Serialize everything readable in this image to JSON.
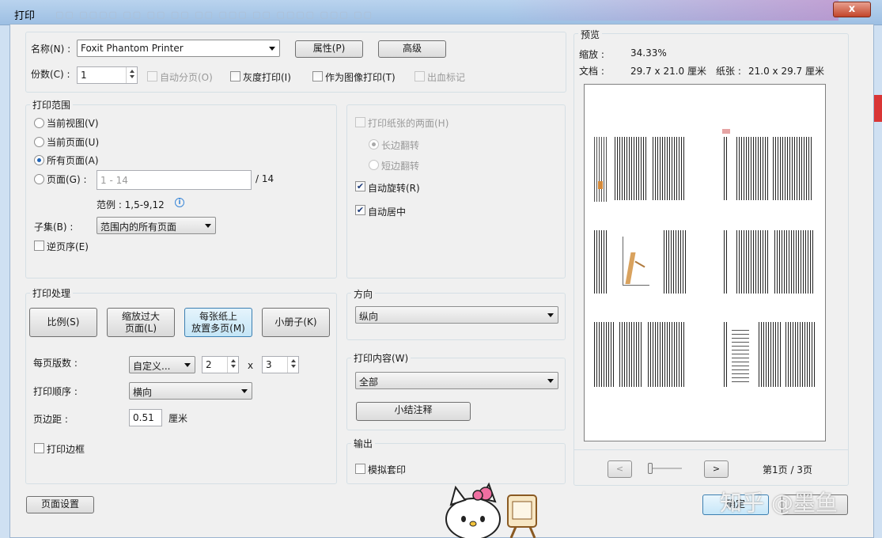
{
  "window": {
    "title": "打印",
    "close_label": "x"
  },
  "printer": {
    "name_label": "名称(N) :",
    "name_value": "Foxit Phantom Printer",
    "properties_button": "属性(P)",
    "advanced_button": "高级",
    "copies_label": "份数(C) :",
    "copies_value": "1",
    "collate_label": "自动分页(O)",
    "grayscale_label": "灰度打印(I)",
    "print_as_image_label": "作为图像打印(T)",
    "bleed_marks_label": "出血标记"
  },
  "range": {
    "legend": "打印范围",
    "current_view": "当前视图(V)",
    "current_page": "当前页面(U)",
    "all_pages": "所有页面(A)",
    "pages": "页面(G) :",
    "pages_placeholder": "1 - 14",
    "pages_total": "/ 14",
    "example": "范例 : 1,5-9,12",
    "subset_label": "子集(B) :",
    "subset_value": "范围内的所有页面",
    "reverse_label": "逆页序(E)"
  },
  "duplex": {
    "both_sides": "打印纸张的两面(H)",
    "long_edge": "长边翻转",
    "short_edge": "短边翻转",
    "auto_rotate": "自动旋转(R)",
    "auto_center": "自动居中"
  },
  "handling": {
    "legend": "打印处理",
    "scale_button": "比例(S)",
    "shrink_button_l1": "缩放过大",
    "shrink_button_l2": "页面(L)",
    "multiple_button_l1": "每张纸上",
    "multiple_button_l2": "放置多页(M)",
    "booklet_button": "小册子(K)",
    "pages_per_sheet_label": "每页版数 :",
    "pages_per_sheet_value": "自定义...",
    "cols_value": "2",
    "times": "x",
    "rows_value": "3",
    "order_label": "打印顺序 :",
    "order_value": "横向",
    "margin_label": "页边距 :",
    "margin_value": "0.51",
    "margin_unit": "厘米",
    "border_label": "打印边框"
  },
  "orientation": {
    "legend": "方向",
    "value": "纵向"
  },
  "content": {
    "legend": "打印内容(W)",
    "value": "全部",
    "summarize_button": "小结注释"
  },
  "output": {
    "legend": "输出",
    "simulate_overprint": "模拟套印"
  },
  "preview": {
    "legend": "预览",
    "zoom_label": "缩放 :",
    "zoom_value": "34.33%",
    "doc_label": "文档 :",
    "doc_value": "29.7 x 21.0 厘米",
    "paper_label": "纸张 :",
    "paper_value": "21.0 x 29.7 厘米",
    "prev_button": "<",
    "next_button": ">",
    "page_indicator": "第1页 / 3页"
  },
  "footer": {
    "page_setup_button": "页面设置",
    "ok_button": "确定"
  },
  "watermark": "知乎 @墨鱼",
  "colors": {
    "titlebar": "#a9c8ea",
    "close": "#c2452a",
    "accent": "#1f63b5"
  }
}
